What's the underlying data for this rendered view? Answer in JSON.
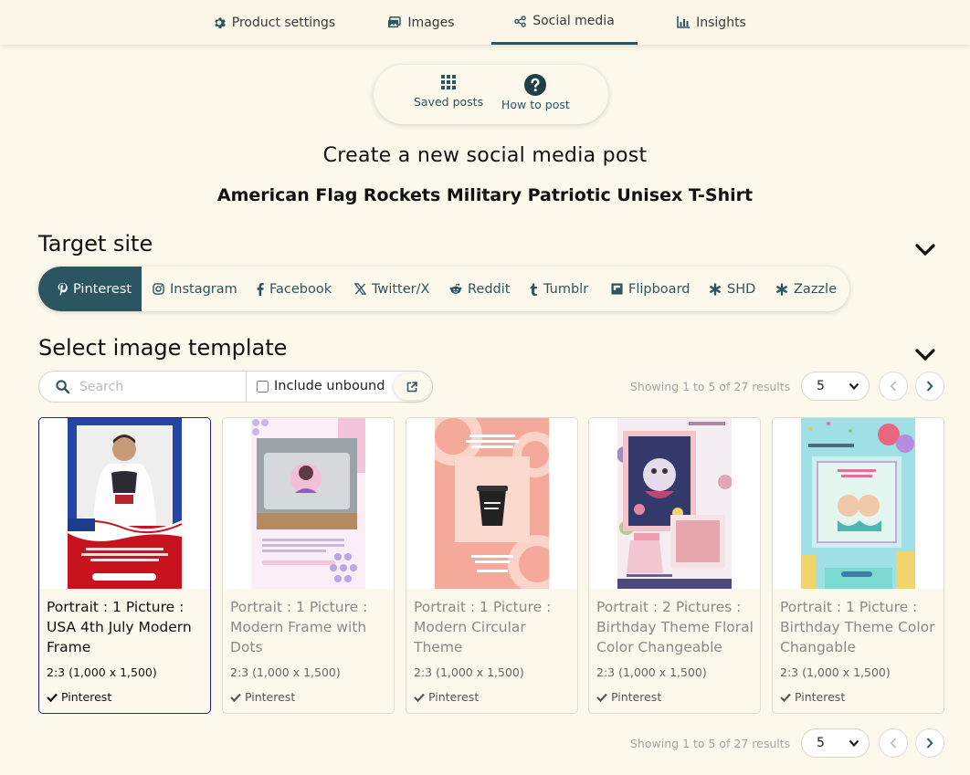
{
  "nav": {
    "tabs": [
      {
        "label": "Product settings",
        "icon": "gear-icon"
      },
      {
        "label": "Images",
        "icon": "images-icon"
      },
      {
        "label": "Social media",
        "icon": "share-icon",
        "active": true
      },
      {
        "label": "Insights",
        "icon": "chart-icon"
      }
    ]
  },
  "quick_actions": {
    "saved_posts": "Saved posts",
    "how_to_post": "How to post"
  },
  "page": {
    "title": "Create a new social media post",
    "product_name": "American Flag Rockets Military Patriotic Unisex T-Shirt"
  },
  "target_site": {
    "heading": "Target site",
    "sites": [
      {
        "label": "Pinterest",
        "icon": "pinterest-icon",
        "active": true
      },
      {
        "label": "Instagram",
        "icon": "instagram-icon"
      },
      {
        "label": "Facebook",
        "icon": "facebook-icon"
      },
      {
        "label": "Twitter/X",
        "icon": "x-icon"
      },
      {
        "label": "Reddit",
        "icon": "reddit-icon"
      },
      {
        "label": "Tumblr",
        "icon": "tumblr-icon"
      },
      {
        "label": "Flipboard",
        "icon": "flipboard-icon"
      },
      {
        "label": "SHD",
        "icon": "asterisk-icon"
      },
      {
        "label": "Zazzle",
        "icon": "asterisk-icon"
      }
    ]
  },
  "template": {
    "heading": "Select image template",
    "search_placeholder": "Search",
    "include_unbound": "Include unbound",
    "showing": "Showing 1 to 5 of 27 results",
    "page_size": "5",
    "cards": [
      {
        "title": "Portrait : 1 Picture : USA 4th July Modern Frame",
        "ratio": "2:3 (1,000 x 1,500)",
        "site": "Pinterest",
        "selected": true
      },
      {
        "title": "Portrait : 1 Picture : Modern Frame with Dots",
        "ratio": "2:3 (1,000 x 1,500)",
        "site": "Pinterest"
      },
      {
        "title": "Portrait : 1 Picture : Modern Circular Theme",
        "ratio": "2:3 (1,000 x 1,500)",
        "site": "Pinterest"
      },
      {
        "title": "Portrait : 2 Pictures : Birthday Theme Floral Color Changeable",
        "ratio": "2:3 (1,000 x 1,500)",
        "site": "Pinterest"
      },
      {
        "title": "Portrait : 1 Picture : Birthday Theme Color Changable",
        "ratio": "2:3 (1,000 x 1,500)",
        "site": "Pinterest"
      }
    ]
  },
  "colors": {
    "accent": "#2b5560",
    "background": "#fdf8ec",
    "selected_border": "#1d1d8f"
  }
}
